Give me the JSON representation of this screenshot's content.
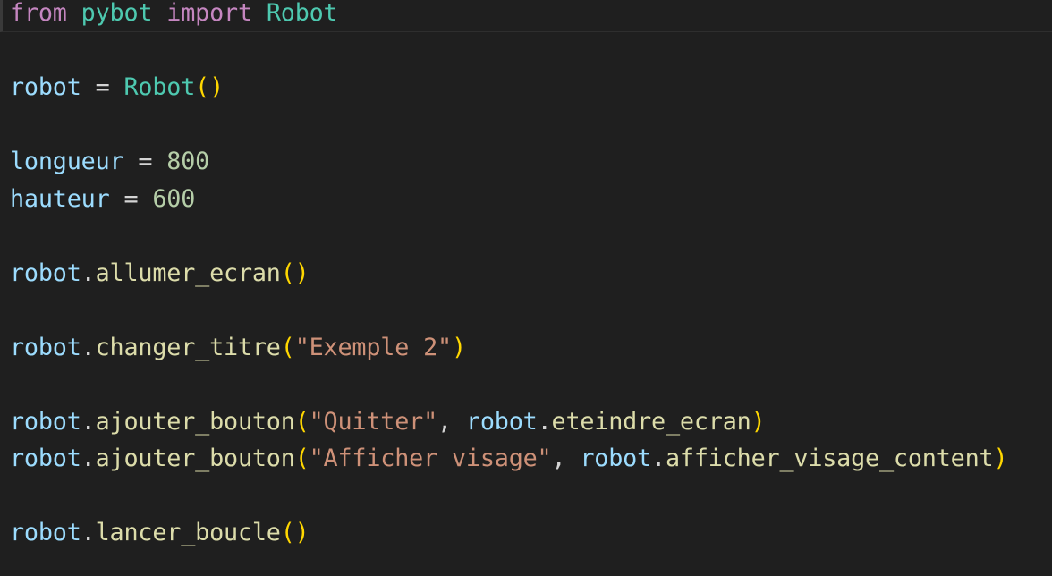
{
  "theme": {
    "background": "#1f1f1f",
    "current_line_border": "#2e2e2e",
    "colors": {
      "keyword": "#c586c0",
      "module": "#4ec9b0",
      "class": "#4ec9b0",
      "variable": "#9cdcfe",
      "operator": "#d4d4d4",
      "number": "#b5cea8",
      "function": "#dcdcaa",
      "string": "#ce9178",
      "bracket": "#ffd700",
      "punctuation": "#d4d4d4"
    }
  },
  "code_lines": [
    [
      {
        "text": "from",
        "type": "keyword"
      },
      {
        "text": " ",
        "type": "punctuation"
      },
      {
        "text": "pybot",
        "type": "module"
      },
      {
        "text": " ",
        "type": "punctuation"
      },
      {
        "text": "import",
        "type": "keyword"
      },
      {
        "text": " ",
        "type": "punctuation"
      },
      {
        "text": "Robot",
        "type": "class"
      }
    ],
    [],
    [
      {
        "text": "robot",
        "type": "variable"
      },
      {
        "text": " = ",
        "type": "operator"
      },
      {
        "text": "Robot",
        "type": "class"
      },
      {
        "text": "()",
        "type": "bracket"
      }
    ],
    [],
    [
      {
        "text": "longueur",
        "type": "variable"
      },
      {
        "text": " = ",
        "type": "operator"
      },
      {
        "text": "800",
        "type": "number"
      }
    ],
    [
      {
        "text": "hauteur",
        "type": "variable"
      },
      {
        "text": " = ",
        "type": "operator"
      },
      {
        "text": "600",
        "type": "number"
      }
    ],
    [],
    [
      {
        "text": "robot",
        "type": "variable"
      },
      {
        "text": ".",
        "type": "punctuation"
      },
      {
        "text": "allumer_ecran",
        "type": "function"
      },
      {
        "text": "()",
        "type": "bracket"
      }
    ],
    [],
    [
      {
        "text": "robot",
        "type": "variable"
      },
      {
        "text": ".",
        "type": "punctuation"
      },
      {
        "text": "changer_titre",
        "type": "function"
      },
      {
        "text": "(",
        "type": "bracket"
      },
      {
        "text": "\"Exemple 2\"",
        "type": "string"
      },
      {
        "text": ")",
        "type": "bracket"
      }
    ],
    [],
    [
      {
        "text": "robot",
        "type": "variable"
      },
      {
        "text": ".",
        "type": "punctuation"
      },
      {
        "text": "ajouter_bouton",
        "type": "function"
      },
      {
        "text": "(",
        "type": "bracket"
      },
      {
        "text": "\"Quitter\"",
        "type": "string"
      },
      {
        "text": ", ",
        "type": "punctuation"
      },
      {
        "text": "robot",
        "type": "variable"
      },
      {
        "text": ".",
        "type": "punctuation"
      },
      {
        "text": "eteindre_ecran",
        "type": "function"
      },
      {
        "text": ")",
        "type": "bracket"
      }
    ],
    [
      {
        "text": "robot",
        "type": "variable"
      },
      {
        "text": ".",
        "type": "punctuation"
      },
      {
        "text": "ajouter_bouton",
        "type": "function"
      },
      {
        "text": "(",
        "type": "bracket"
      },
      {
        "text": "\"Afficher visage\"",
        "type": "string"
      },
      {
        "text": ", ",
        "type": "punctuation"
      },
      {
        "text": "robot",
        "type": "variable"
      },
      {
        "text": ".",
        "type": "punctuation"
      },
      {
        "text": "afficher_visage_content",
        "type": "function"
      },
      {
        "text": ")",
        "type": "bracket"
      }
    ],
    [],
    [
      {
        "text": "robot",
        "type": "variable"
      },
      {
        "text": ".",
        "type": "punctuation"
      },
      {
        "text": "lancer_boucle",
        "type": "function"
      },
      {
        "text": "()",
        "type": "bracket"
      }
    ]
  ]
}
